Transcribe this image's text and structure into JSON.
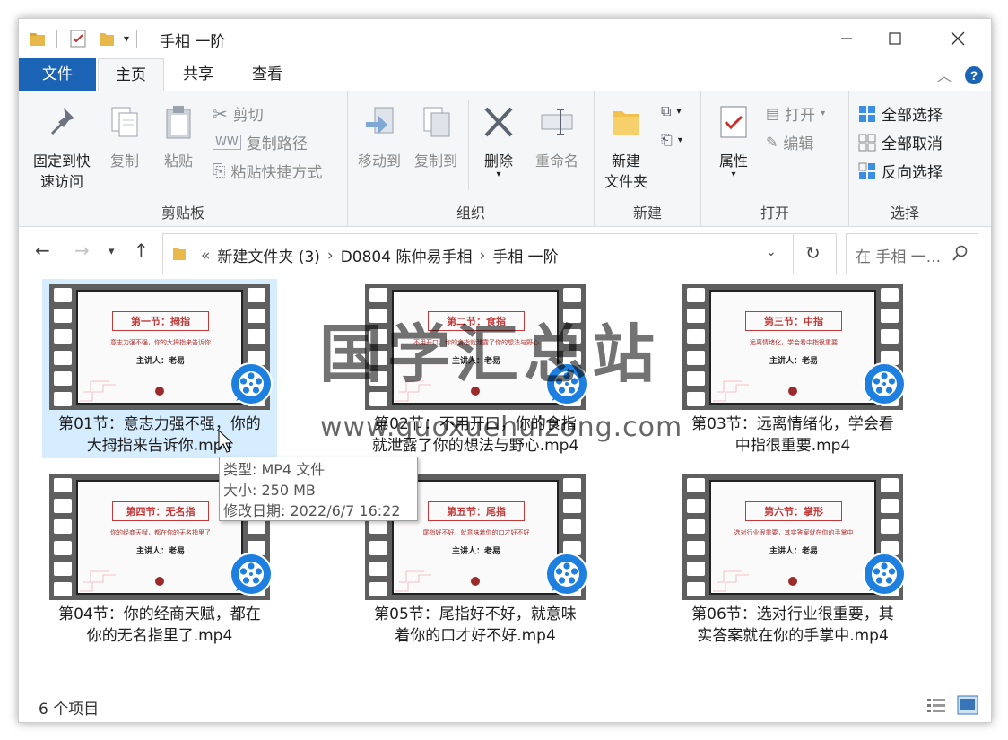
{
  "window": {
    "title": "手相 一阶"
  },
  "tabs": {
    "file": "文件",
    "home": "主页",
    "share": "共享",
    "view": "查看"
  },
  "ribbon": {
    "clipboard": {
      "label": "剪贴板",
      "pin": "固定到快\n速访问",
      "pin_line1": "固定到快",
      "pin_line2": "速访问",
      "copy": "复制",
      "paste": "粘贴",
      "cut": "剪切",
      "copy_path": "复制路径",
      "paste_shortcut": "粘贴快捷方式"
    },
    "organize": {
      "label": "组织",
      "move_to": "移动到",
      "copy_to": "复制到",
      "delete": "删除",
      "rename": "重命名"
    },
    "new": {
      "label": "新建",
      "new_folder_line1": "新建",
      "new_folder_line2": "文件夹"
    },
    "open": {
      "label": "打开",
      "properties": "属性",
      "open": "打开",
      "edit": "编辑"
    },
    "select": {
      "label": "选择",
      "select_all": "全部选择",
      "select_none": "全部取消",
      "invert": "反向选择"
    }
  },
  "address": {
    "overflow": "«",
    "crumbs": [
      "新建文件夹 (3)",
      "D0804 陈仲易手相",
      "手相 一阶"
    ],
    "search_placeholder": "在 手相 一..."
  },
  "files": [
    {
      "line1": "第01节：意志力强不强，你的",
      "line2": "大拇指来告诉你.mp4",
      "slide_title": "第一节：拇指",
      "slide_sub": "意志力强不强，你的大拇指来告诉你",
      "lecturer": "主讲人：老易"
    },
    {
      "line1": "第02节：不用开口，你的食指",
      "line2": "就泄露了你的想法与野心.mp4",
      "slide_title": "第二节：食指",
      "slide_sub": "不用开口，你的食指就泄露了你的想法与野心",
      "lecturer": "主讲人：老易"
    },
    {
      "line1": "第03节：远离情绪化，学会看",
      "line2": "中指很重要.mp4",
      "slide_title": "第三节：中指",
      "slide_sub": "远离情绪化，学会看中指很重要",
      "lecturer": "主讲人：老易"
    },
    {
      "line1": "第04节：你的经商天赋，都在",
      "line2": "你的无名指里了.mp4",
      "slide_title": "第四节：无名指",
      "slide_sub": "你的经商天赋，都在你的无名指里了",
      "lecturer": "主讲人：老易"
    },
    {
      "line1": "第05节：尾指好不好，就意味",
      "line2": "着你的口才好不好.mp4",
      "slide_title": "第五节：尾指",
      "slide_sub": "尾指好不好，就意味着你的口才好不好",
      "lecturer": "主讲人：老易"
    },
    {
      "line1": "第06节：选对行业很重要，其",
      "line2": "实答案就在你的手掌中.mp4",
      "slide_title": "第六节：掌形",
      "slide_sub": "选对行业很重要，其实答案就在你的手掌中",
      "lecturer": "主讲人：老易"
    }
  ],
  "tooltip": {
    "type": "类型: MP4 文件",
    "size": "大小: 250 MB",
    "modified": "修改日期: 2022/6/7 16:22"
  },
  "status": {
    "count": "6 个项目"
  },
  "watermark": {
    "text": "国学汇总站",
    "url": "www.guoxuehuizong.com"
  },
  "colors": {
    "accent": "#1a63b5",
    "selection": "#cce8ff",
    "slide_red": "#c23a3a",
    "badge_blue": "#1d7fe0"
  }
}
